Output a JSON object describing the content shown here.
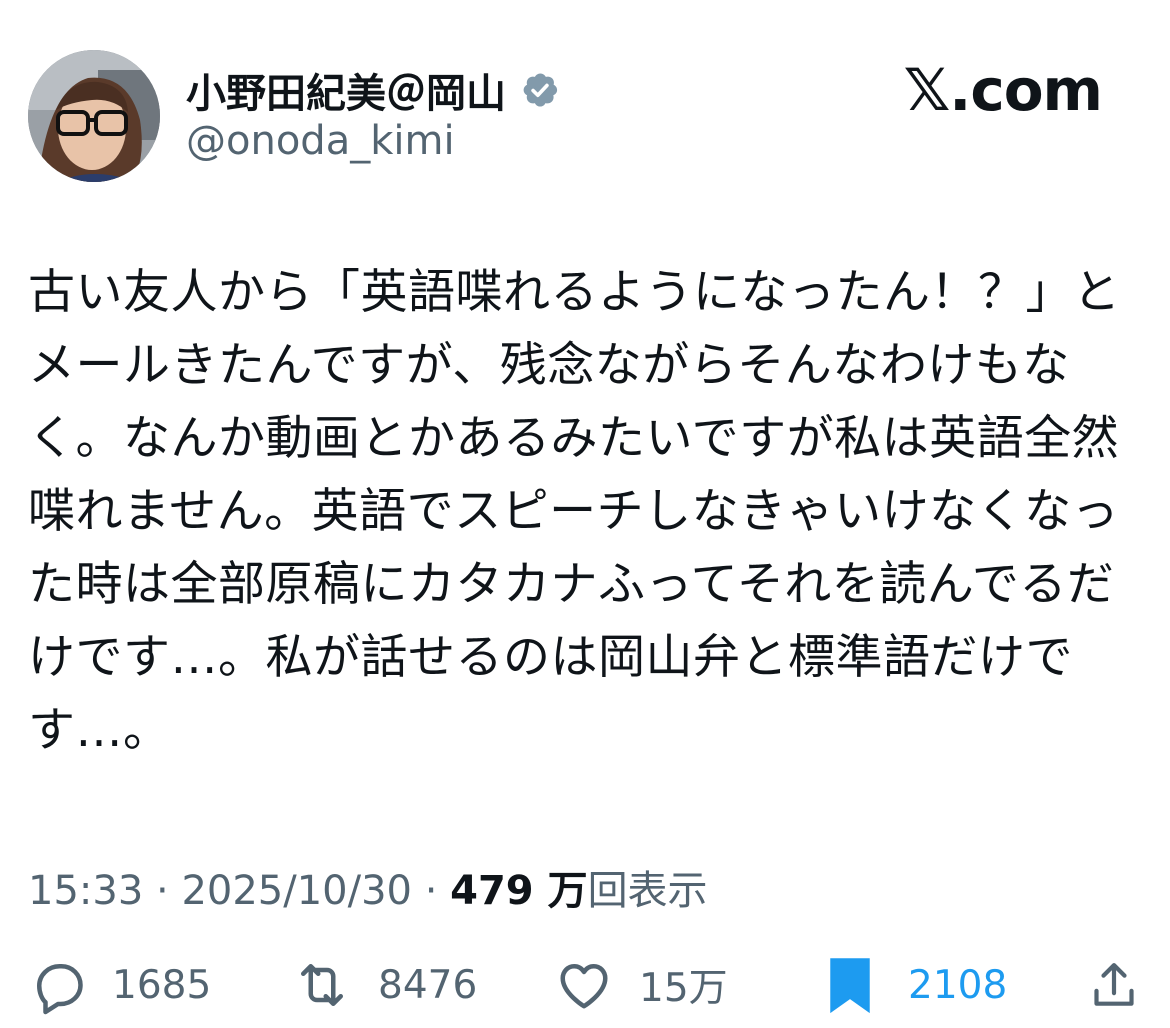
{
  "author": {
    "display_name": "小野田紀美＠岡山",
    "handle": "@onoda_kimi",
    "verified": true
  },
  "brand": "𝕏.com",
  "tweet": {
    "lines": [
      "古い友人から「英語喋れるようになったん！？」と",
      "メールきたんですが、残念ながらそんなわけもな",
      "く。なんか動画とかあるみたいですが私は英語全然",
      "喋れません。英語でスピーチしなきゃいけなくなっ",
      "た時は全部原稿にカタカナふってそれを読んでるだ",
      "けです…。私が話せるのは岡山弁と標準語だけで",
      "す…。"
    ]
  },
  "meta": {
    "time": "15:33",
    "separator": "·",
    "date": "2025/10/30",
    "views_count": "479 万",
    "views_label": "回表示"
  },
  "actions": {
    "replies": "1685",
    "retweets": "8476",
    "likes": "15万",
    "bookmarks": "2108"
  },
  "icons": {
    "reply": "reply-icon",
    "retweet": "retweet-icon",
    "like": "heart-icon",
    "bookmark": "bookmark-icon",
    "share": "share-icon",
    "verified": "verified-badge-icon"
  },
  "colors": {
    "text": "#0f1419",
    "secondary": "#536471",
    "accent": "#1d9bf0",
    "verified_badge": "#829aab"
  }
}
